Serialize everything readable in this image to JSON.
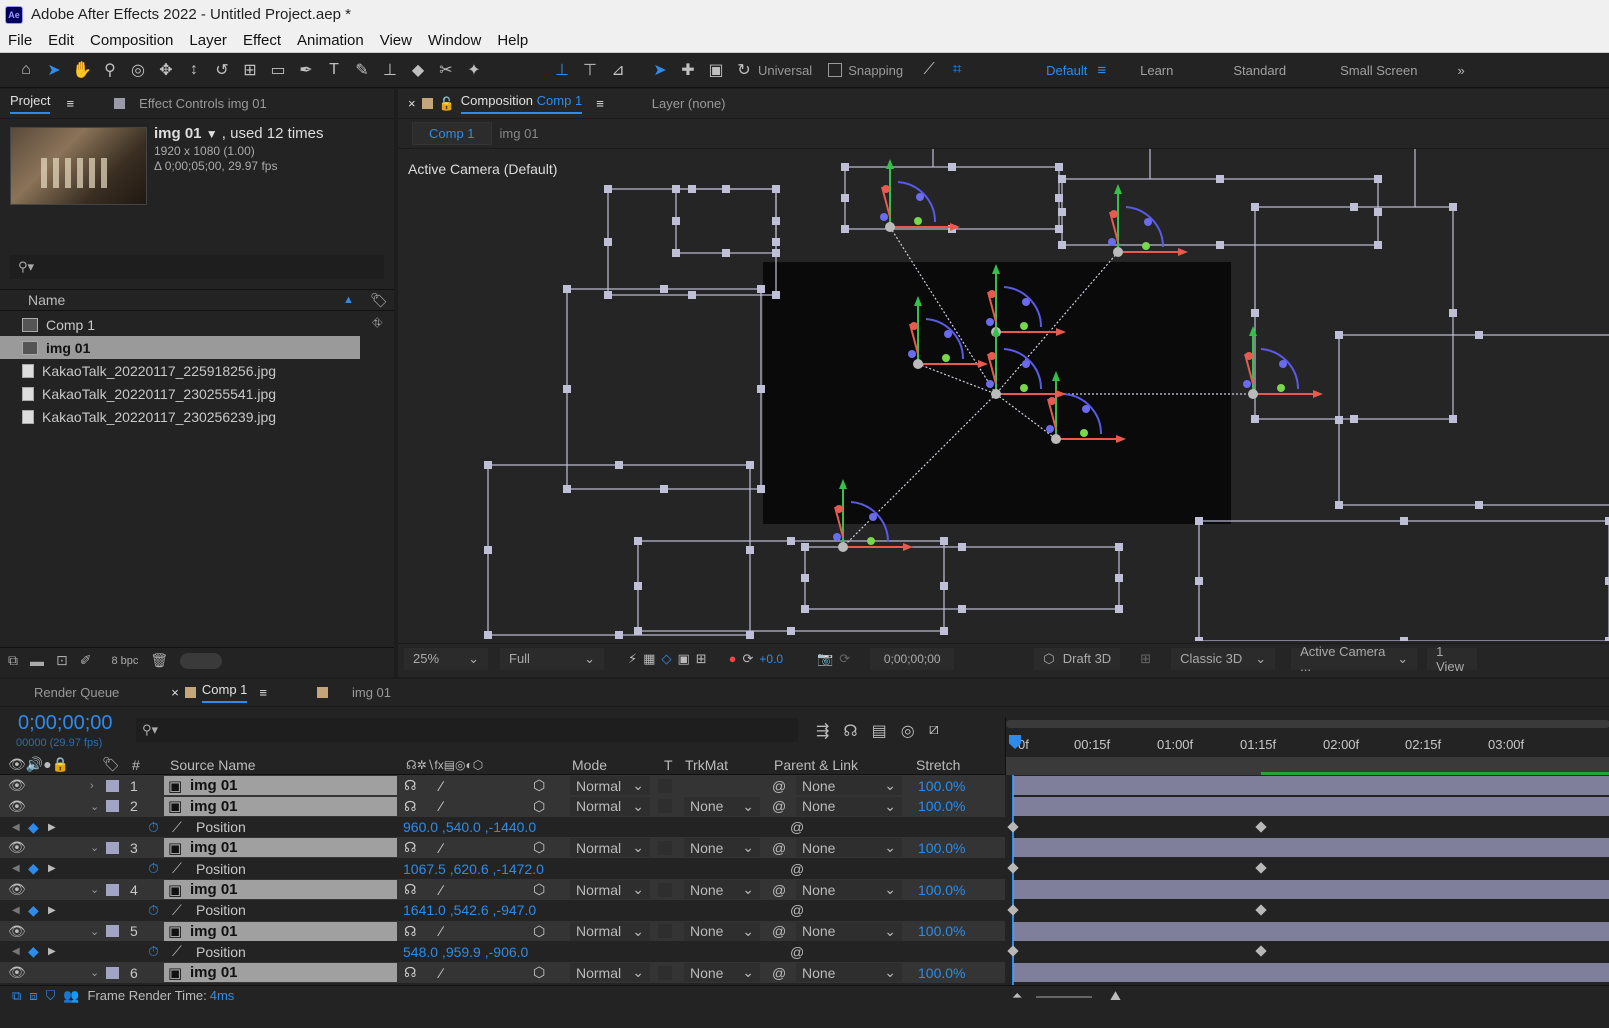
{
  "app": {
    "title": "Adobe After Effects 2022 - Untitled Project.aep *",
    "logo": "Ae"
  },
  "menu": [
    "File",
    "Edit",
    "Composition",
    "Layer",
    "Effect",
    "Animation",
    "View",
    "Window",
    "Help"
  ],
  "toolbar": {
    "tools": [
      "home-icon",
      "selection-icon",
      "hand-icon",
      "zoom-icon",
      "orbit-icon",
      "pan-icon",
      "dolly-icon",
      "rotate-icon",
      "pan-behind-icon",
      "rectangle-icon",
      "pen-icon",
      "type-icon",
      "brush-icon",
      "stamp-icon",
      "eraser-icon",
      "roto-icon",
      "puppet-icon"
    ],
    "axis_mode": "Universal",
    "snapping": "Snapping",
    "workspaces": [
      "Default",
      "Learn",
      "Standard",
      "Small Screen"
    ],
    "active_workspace": "Default"
  },
  "project": {
    "tab": "Project",
    "effect_tab": "Effect Controls img 01",
    "item_name": "img 01",
    "used": ", used 12 times",
    "dims": "1920 x 1080 (1.00)",
    "duration": "Δ 0;00;05;00, 29.97 fps",
    "search_placeholder": "",
    "col_name": "Name",
    "items": [
      {
        "name": "Comp 1",
        "type": "comp"
      },
      {
        "name": "img 01",
        "type": "footage",
        "selected": true
      },
      {
        "name": "KakaoTalk_20220117_225918256.jpg",
        "type": "image"
      },
      {
        "name": "KakaoTalk_20220117_230255541.jpg",
        "type": "image"
      },
      {
        "name": "KakaoTalk_20220117_230256239.jpg",
        "type": "image"
      }
    ],
    "bpc": "8 bpc"
  },
  "composition": {
    "tab_label": "Composition",
    "tab_name": "Comp 1",
    "layer_tab": "Layer (none)",
    "breadcrumbs": [
      "Comp 1",
      "img 01"
    ],
    "camera_label": "Active Camera (Default)",
    "zoom": "25%",
    "resolution": "Full",
    "exposure": "+0.0",
    "timecode": "0;00;00;00",
    "draft": "Draft 3D",
    "renderer": "Classic 3D",
    "view": "Active Camera ...",
    "views": "1 View"
  },
  "timeline": {
    "tabs": [
      "Render Queue",
      "Comp 1",
      "img 01"
    ],
    "time": "0;00;00;00",
    "frames": "00000 (29.97 fps)",
    "ruler": [
      "0f",
      "00:15f",
      "01:00f",
      "01:15f",
      "02:00f",
      "02:15f",
      "03:00f"
    ],
    "headers": {
      "num": "#",
      "source": "Source Name",
      "mode": "Mode",
      "t": "T",
      "trkmat": "TrkMat",
      "parent": "Parent & Link",
      "stretch": "Stretch"
    },
    "layers": [
      {
        "num": "1",
        "name": "img 01",
        "mode": "Normal",
        "trkmat": "",
        "parent": "None",
        "stretch": "100.0%",
        "expanded": false
      },
      {
        "num": "2",
        "name": "img 01",
        "mode": "Normal",
        "trkmat": "None",
        "parent": "None",
        "stretch": "100.0%",
        "expanded": true,
        "prop": "Position",
        "value": "960.0 ,540.0 ,-1440.0"
      },
      {
        "num": "3",
        "name": "img 01",
        "mode": "Normal",
        "trkmat": "None",
        "parent": "None",
        "stretch": "100.0%",
        "expanded": true,
        "prop": "Position",
        "value": "1067.5 ,620.6 ,-1472.0"
      },
      {
        "num": "4",
        "name": "img 01",
        "mode": "Normal",
        "trkmat": "None",
        "parent": "None",
        "stretch": "100.0%",
        "expanded": true,
        "prop": "Position",
        "value": "1641.0 ,542.6 ,-947.0"
      },
      {
        "num": "5",
        "name": "img 01",
        "mode": "Normal",
        "trkmat": "None",
        "parent": "None",
        "stretch": "100.0%",
        "expanded": true,
        "prop": "Position",
        "value": "548.0 ,959.9 ,-906.0"
      },
      {
        "num": "6",
        "name": "img 01",
        "mode": "Normal",
        "trkmat": "None",
        "parent": "None",
        "stretch": "100.0%",
        "expanded": true
      }
    ],
    "render_label": "Frame Render Time:",
    "render_time": "4ms"
  },
  "colors": {
    "accent": "#2d8ceb",
    "layer_bar": "#8f8fb0",
    "green": "#26a43b"
  }
}
